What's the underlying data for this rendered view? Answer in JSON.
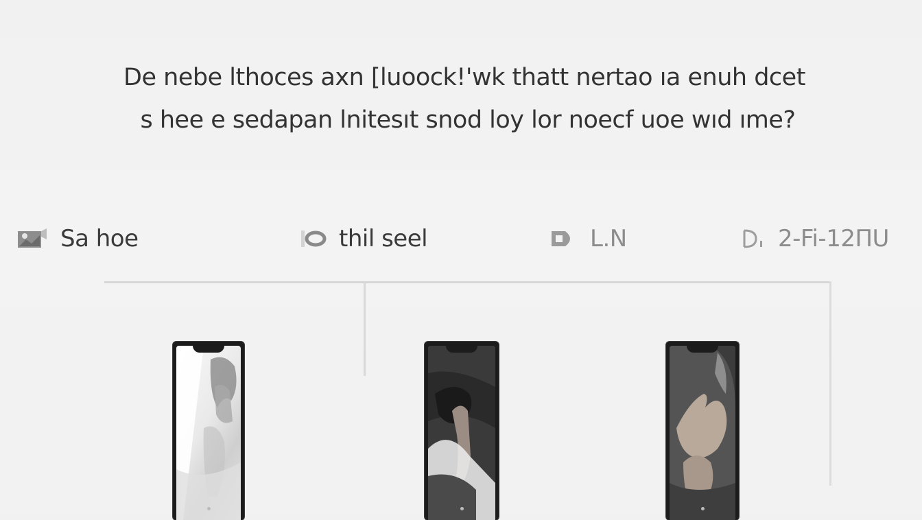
{
  "headline": {
    "line1": "De  nebe lthoces axn [luoock!'wk  thatt nertao ıa  enuh dcet",
    "line2": "s hee e sedapan lnitesıt snod loy lor  noecf uoe wıd ıme?"
  },
  "toolbar": {
    "items": [
      {
        "label": "Sa hoe",
        "icon": "photo-icon"
      },
      {
        "label": "thil seel",
        "icon": "toggle-icon"
      },
      {
        "label": "L.N",
        "icon": "play-icon"
      },
      {
        "label": "2-Fi-12ΠU",
        "icon": "document-icon"
      }
    ]
  },
  "phones": [
    {
      "name": "phone-preview-light",
      "screen": "light"
    },
    {
      "name": "phone-preview-dark",
      "screen": "dark"
    },
    {
      "name": "phone-preview-hands",
      "screen": "medium"
    }
  ],
  "colors": {
    "background": "#f2f2f2",
    "text": "#333333",
    "frame": "#d6d6d6",
    "phone_body": "#1c1c1c"
  }
}
